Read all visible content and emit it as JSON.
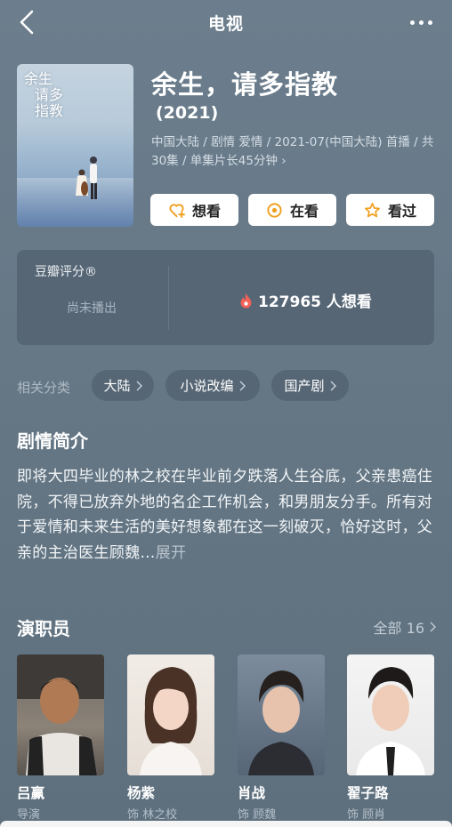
{
  "header": {
    "title": "电视",
    "back_icon": "chevron-left-icon",
    "more_icon": "more-dots-icon"
  },
  "movie": {
    "title": "余生，请多指教",
    "year": "(2021)",
    "meta": "中国大陆 / 剧情 爱情 / 2021-07(中国大陆) 首播 / 共30集 / 单集片长45分钟 ›",
    "poster_text": [
      "余生",
      "请多",
      "指教"
    ]
  },
  "actions": [
    {
      "label": "想看",
      "icon": "heart-plus-icon"
    },
    {
      "label": "在看",
      "icon": "target-icon"
    },
    {
      "label": "看过",
      "icon": "star-icon"
    }
  ],
  "rating": {
    "label": "豆瓣评分®",
    "status": "尚未播出",
    "want_count": "127965 人想看",
    "accent": "#f26157"
  },
  "categories": {
    "label": "相关分类",
    "items": [
      "大陆",
      "小说改编",
      "国产剧"
    ]
  },
  "synopsis": {
    "title": "剧情简介",
    "text": "即将大四毕业的林之校在毕业前夕跌落人生谷底，父亲患癌住院，不得已放弃外地的名企工作机会，和男朋友分手。所有对于爱情和未来生活的美好想象都在这一刻破灭，恰好这时，父亲的主治医生顾魏…",
    "expand": "展开"
  },
  "cast": {
    "title": "演职员",
    "all_label": "全部 16",
    "members": [
      {
        "name": "吕赢",
        "role": "导演"
      },
      {
        "name": "杨紫",
        "role": "饰 林之校"
      },
      {
        "name": "肖战",
        "role": "饰 顾魏"
      },
      {
        "name": "翟子路",
        "role": "饰 顾肖"
      }
    ]
  },
  "colors": {
    "accent": "#f0a020",
    "background": "#677987",
    "card": "#566675"
  }
}
